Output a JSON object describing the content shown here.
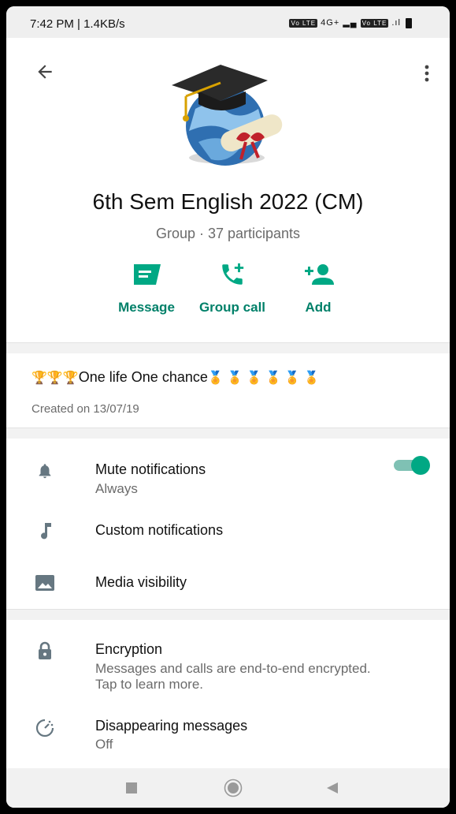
{
  "status_bar": {
    "time": "7:42 PM | 1.4KB/s",
    "volte1": "Vo LTE",
    "net": "4G+",
    "volte2": "Vo LTE"
  },
  "header": {
    "group_name": "6th Sem English 2022 (CM)",
    "group_subtitle": "Group · 37 participants",
    "actions": [
      {
        "label": "Message",
        "icon": "message-icon"
      },
      {
        "label": "Group call",
        "icon": "add-call-icon"
      },
      {
        "label": "Add",
        "icon": "add-person-icon"
      }
    ]
  },
  "description": {
    "text": "One life One chance",
    "trophies": "🏆🏆🏆",
    "medals": "🏅 🏅 🏅 🏅 🏅 🏅",
    "created": "Created on 13/07/19"
  },
  "settings": {
    "mute": {
      "title": "Mute notifications",
      "subtitle": "Always",
      "enabled": true,
      "icon": "bell-icon"
    },
    "custom": {
      "title": "Custom notifications",
      "icon": "music-note-icon"
    },
    "media": {
      "title": "Media visibility",
      "icon": "image-icon"
    }
  },
  "privacy": {
    "encryption": {
      "title": "Encryption",
      "subtitle": "Messages and calls are end-to-end encrypted. Tap to learn more.",
      "icon": "lock-icon"
    },
    "disappearing": {
      "title": "Disappearing messages",
      "subtitle": "Off",
      "icon": "timer-icon"
    }
  },
  "colors": {
    "accent": "#008069",
    "toggle": "#00a884",
    "divider": "#f2f2f2"
  },
  "navbar": {
    "icons": [
      "square-icon",
      "home-circle-icon",
      "back-triangle-icon"
    ]
  }
}
